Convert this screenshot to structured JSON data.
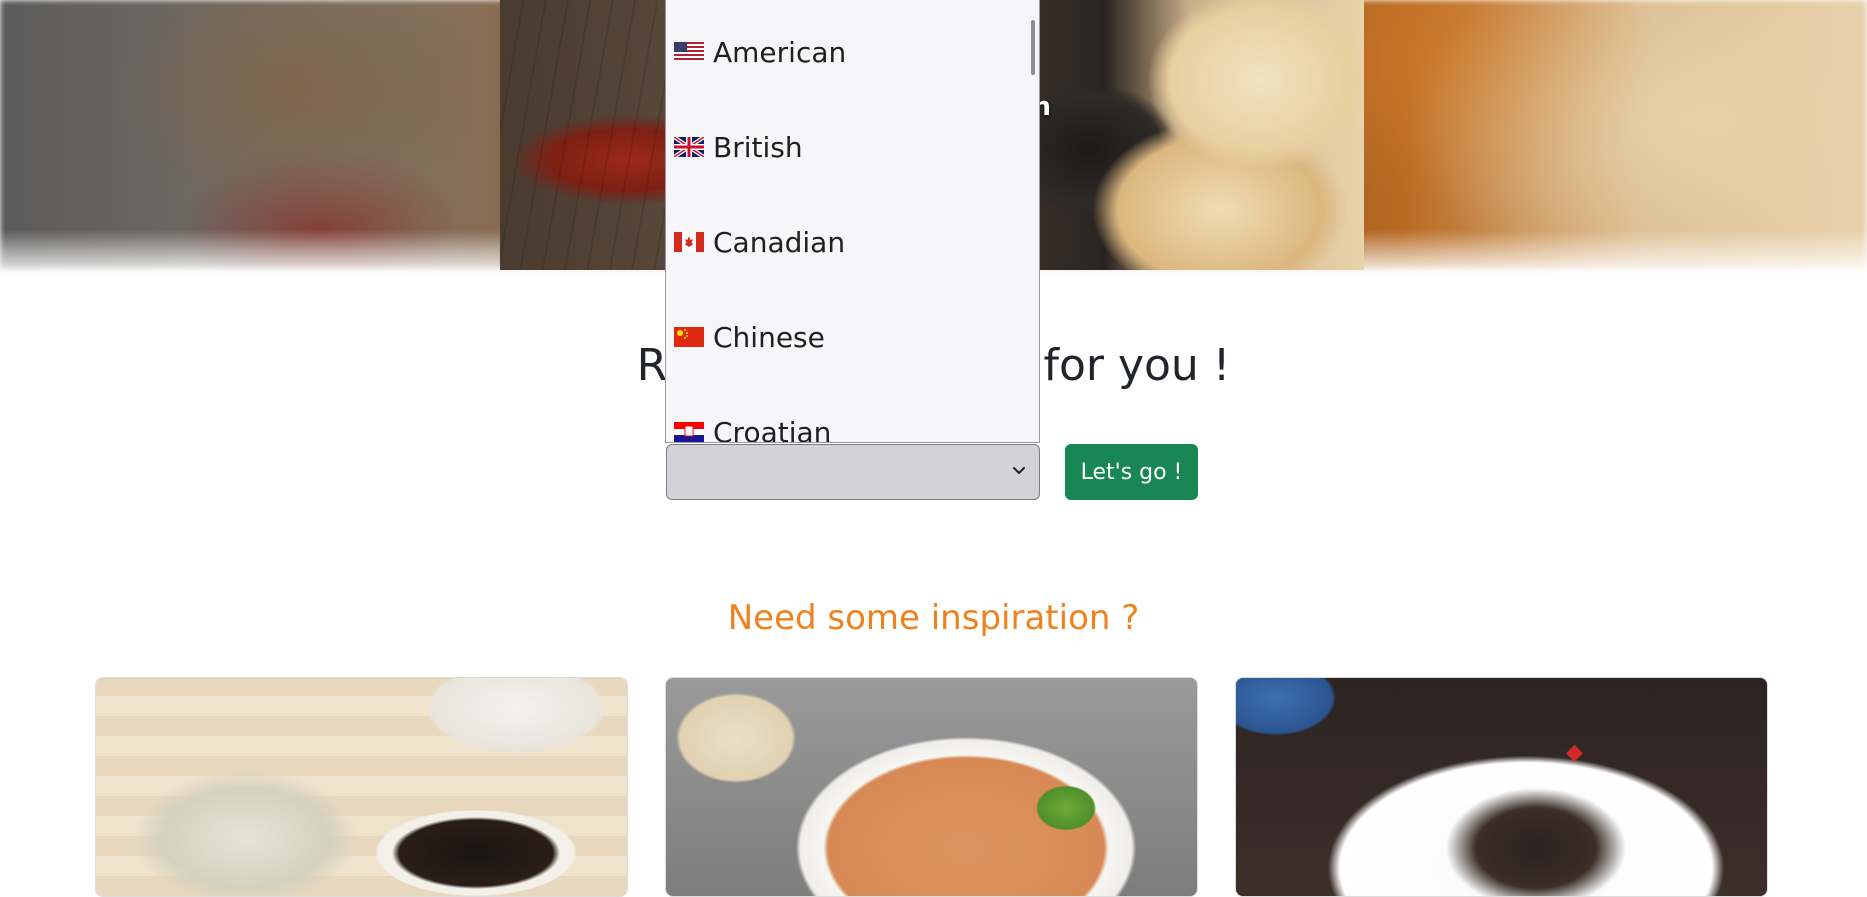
{
  "hero": {
    "caption": "an"
  },
  "main": {
    "title": "Recipes f                    orld just for you !",
    "go_button_label": "Let's go !",
    "inspiration_heading": "Need some inspiration ?"
  },
  "dropdown": {
    "selected_value": "",
    "options": [
      {
        "label": "American",
        "flag": "us-flag-icon"
      },
      {
        "label": "British",
        "flag": "uk-flag-icon"
      },
      {
        "label": "Canadian",
        "flag": "canada-flag-icon"
      },
      {
        "label": "Chinese",
        "flag": "china-flag-icon"
      },
      {
        "label": "Croatian",
        "flag": "croatia-flag-icon"
      }
    ]
  },
  "cards": [
    {
      "name": "inspiration-card-1"
    },
    {
      "name": "inspiration-card-2"
    },
    {
      "name": "inspiration-card-3"
    }
  ],
  "colors": {
    "accent_orange": "#f0821e",
    "button_green": "#198754",
    "select_bg": "#d3d3d7",
    "dropdown_bg": "#f6f6f9"
  }
}
